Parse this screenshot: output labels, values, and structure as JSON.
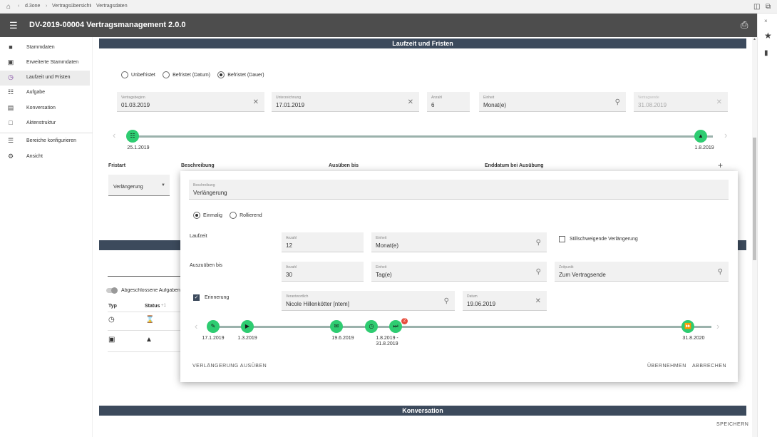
{
  "breadcrumb": [
    "d.3one",
    "Vertragsübersicht",
    "Vertragsdaten"
  ],
  "app": {
    "title": "DV-2019-00004 Vertragsmanagement 2.0.0"
  },
  "sidebar": {
    "items": [
      {
        "label": "Stammdaten",
        "icon": "document-icon"
      },
      {
        "label": "Erweiterte Stammdaten",
        "icon": "document-plus-icon"
      },
      {
        "label": "Laufzeit und Fristen",
        "icon": "clock-icon",
        "active": true
      },
      {
        "label": "Aufgabe",
        "icon": "calendar-icon"
      },
      {
        "label": "Konversation",
        "icon": "chat-icon"
      },
      {
        "label": "Aktenstruktur",
        "icon": "folder-icon"
      },
      {
        "label": "Bereiche konfigurieren",
        "icon": "list-icon"
      },
      {
        "label": "Ansicht",
        "icon": "gear-icon"
      }
    ]
  },
  "section": {
    "laufzeit_title": "Laufzeit und Fristen",
    "konversation_title": "Konversation"
  },
  "duration_type": {
    "options": [
      "Unbefristet",
      "Befristet (Datum)",
      "Befristet (Dauer)"
    ],
    "selected": "Befristet (Dauer)"
  },
  "fields": {
    "vertragsbeginn": {
      "label": "Vertragsbeginn",
      "value": "01.03.2019"
    },
    "unterzeichnung": {
      "label": "Unterzeichnung",
      "value": "17.01.2019"
    },
    "anzahl": {
      "label": "Anzahl",
      "value": "6"
    },
    "einheit": {
      "label": "Einheit",
      "value": "Monat(e)"
    },
    "vertragsende": {
      "label": "Vertragsende",
      "value": "31.08.2019"
    }
  },
  "main_timeline": {
    "start_label": "25.1.2019",
    "end_label": "1.8.2019"
  },
  "fristen_table": {
    "headers": [
      "Fristart",
      "Beschreibung",
      "Ausüben bis",
      "Enddatum bei Ausübung"
    ],
    "fristart_value": "Verlängerung"
  },
  "bg_panel": {
    "toggle_label": "Abgeschlossene Aufgaben",
    "col_typ": "Typ",
    "col_status": "Status",
    "status_sort": "+1"
  },
  "dialog": {
    "beschreibung_label": "Beschreibung",
    "beschreibung_value": "Verlängerung",
    "mode_options": [
      "Einmalig",
      "Rollierend"
    ],
    "mode_selected": "Einmalig",
    "laufzeit_label": "Laufzeit",
    "laufzeit_anzahl_label": "Anzahl",
    "laufzeit_anzahl": "12",
    "laufzeit_einheit_label": "Einheit",
    "laufzeit_einheit": "Monat(e)",
    "stillschweigend_label": "Stillschweigende Verlängerung",
    "stillschweigend_checked": false,
    "ausueben_label": "Auszuüben bis",
    "ausueben_anzahl_label": "Anzahl",
    "ausueben_anzahl": "30",
    "ausueben_einheit_label": "Einheit",
    "ausueben_einheit": "Tag(e)",
    "zeitpunkt_label": "Zeitpunkt",
    "zeitpunkt_value": "Zum Vertragsende",
    "erinnerung_label": "Erinnerung",
    "erinnerung_checked": true,
    "verantwortlich_label": "Verantwortlich",
    "verantwortlich_value": "Nicole Hillenkötter [ntem]",
    "datum_label": "Datum",
    "datum_value": "19.06.2019",
    "timeline_labels": [
      "17.1.2019",
      "1.3.2019",
      "19.6.2019",
      "1.8.2019 -",
      "31.8.2019",
      "31.8.2020"
    ],
    "badge_count": "2",
    "btn_ausueben": "VERLÄNGERUNG AUSÜBEN",
    "btn_uebernehmen": "ÜBERNEHMEN",
    "btn_abbrechen": "ABBRECHEN"
  },
  "footer": {
    "save_label": "SPEICHERN"
  },
  "colors": {
    "accent_node": "#2ecc71",
    "section_header": "#3c4a5c",
    "titlebar": "#4d4d4d",
    "active_icon": "#7b3f9e",
    "badge": "#e74c3c"
  }
}
